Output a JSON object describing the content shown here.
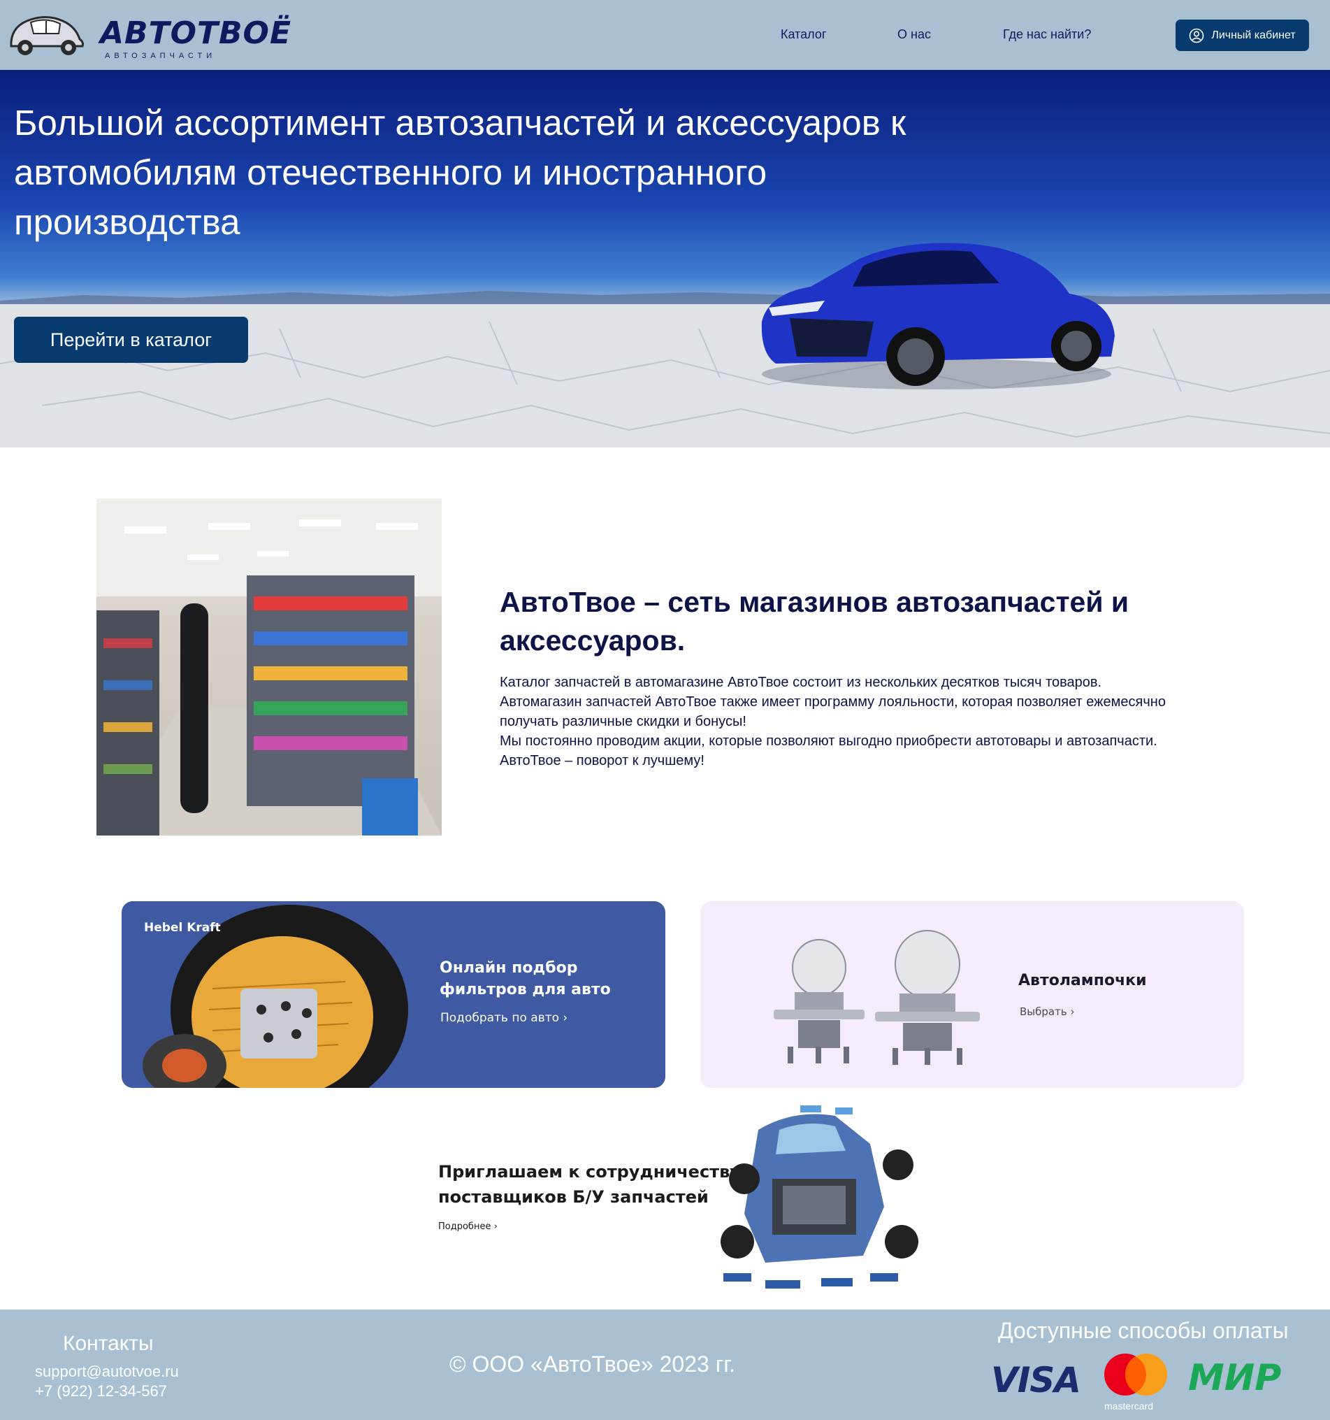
{
  "header": {
    "logo_text": "АВТОТВОЁ",
    "logo_sub": "АВТОЗАПЧАСТИ",
    "nav": [
      {
        "label": "Каталог"
      },
      {
        "label": "О нас"
      },
      {
        "label": "Где нас найти?"
      }
    ],
    "account_label": "Личный кабинет"
  },
  "hero": {
    "title": "Большой ассортимент автозапчастей и аксессуаров к автомобилям отечественного и иностранного производства",
    "cta_label": "Перейти в каталог"
  },
  "about": {
    "title": "АвтоТвое – сеть магазинов автозапчастей и аксессуаров.",
    "paragraphs": [
      "Каталог запчастей в автомагазине АвтоТвое состоит из нескольких десятков тысяч товаров.",
      "Автомагазин запчастей АвтоТвое также имеет программу лояльности, которая позволяет ежемесячно получать различные скидки и бонусы!",
      "Мы постоянно проводим акции, которые позволяют выгодно приобрести автотовары и автозапчасти.",
      "АвтоТвое – поворот к лучшему!"
    ]
  },
  "promos": {
    "filters": {
      "brand": "Hebel Kraft",
      "title_line1": "Онлайн подбор",
      "title_line2": "фильтров для авто",
      "link": "Подобрать по авто ›"
    },
    "lamps": {
      "title": "Автолампочки",
      "link": "Выбрать ›"
    },
    "suppliers": {
      "title_line1": "Приглашаем к сотрудничеству",
      "title_line2": "поставщиков Б/У запчастей",
      "link": "Подробнее ›"
    }
  },
  "footer": {
    "contacts_title": "Контакты",
    "email": "support@autotvoe.ru",
    "phone": "+7 (922) 12-34-567",
    "copyright": "© ООО «АвтоТвое» 2023 гг.",
    "payment_title": "Доступные способы оплаты",
    "payment_methods": [
      "VISA",
      "mastercard",
      "МИР"
    ]
  },
  "colors": {
    "header_bg": "#a9c0d3",
    "brand_navy": "#073a6f",
    "text_dark": "#0d1247",
    "filter_card": "#3f5aa3",
    "lamp_card": "#f5ecfa"
  }
}
